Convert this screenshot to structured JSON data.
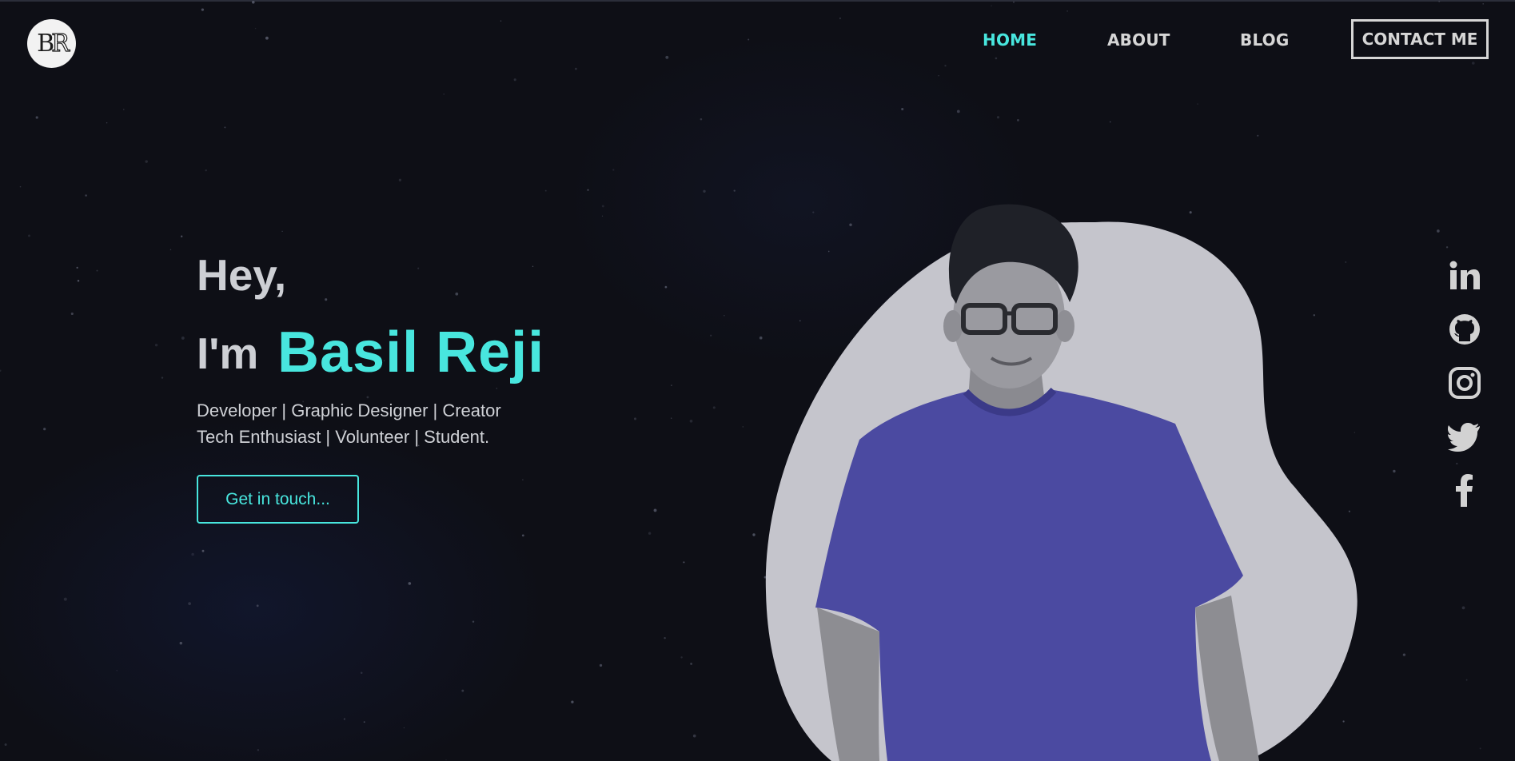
{
  "logo": {
    "text_left": "B",
    "text_right": "R"
  },
  "nav": {
    "home": "HOME",
    "about": "ABOUT",
    "blog": "BLOG",
    "contact": "CONTACT ME",
    "active": "HOME"
  },
  "hero": {
    "greeting": "Hey,",
    "intro": "I'm",
    "name": "Basil Reji",
    "tagline_line1": "Developer | Graphic Designer | Creator",
    "tagline_line2": "Tech Enthusiast | Volunteer | Student.",
    "cta_label": "Get in touch..."
  },
  "social_icons": [
    "linkedin-icon",
    "github-icon",
    "instagram-icon",
    "twitter-icon",
    "facebook-icon"
  ],
  "colors": {
    "background": "#0e0f16",
    "accent": "#48e6de",
    "text": "#cdcfd4",
    "blob": "#c5c5cc",
    "shirt": "#4b4aa1"
  }
}
